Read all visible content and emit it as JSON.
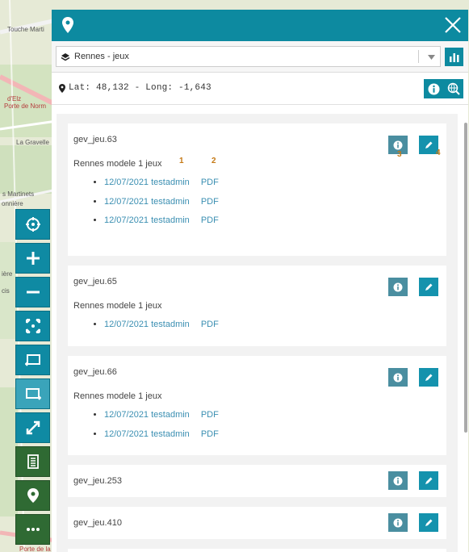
{
  "map": {
    "labels": {
      "touche": "Touche Marti",
      "porte_norm": "Porte de Norm",
      "elz": "d'Elz",
      "gravelle": "La Gravelle",
      "martinets": "s Martinets",
      "onniere": "onnière",
      "iere": "ière",
      "cis": "cis",
      "porte_bottom": "Porte de la"
    }
  },
  "toolbar": {
    "items": [
      {
        "name": "locate-icon"
      },
      {
        "name": "zoom-in-icon"
      },
      {
        "name": "zoom-out-icon"
      },
      {
        "name": "full-extent-icon"
      },
      {
        "name": "previous-extent-icon"
      },
      {
        "name": "next-extent-icon"
      },
      {
        "name": "fullscreen-icon"
      },
      {
        "name": "list-icon"
      },
      {
        "name": "map-marker-icon"
      },
      {
        "name": "more-icon"
      }
    ]
  },
  "panel": {
    "layer_select_value": "Rennes - jeux",
    "coordinates": "Lat: 48,132 - Long: -1,643",
    "items": [
      {
        "title": "gev_jeu.63",
        "subtitle": "Rennes modele 1 jeux",
        "docs": [
          {
            "link": "12/07/2021 testadmin",
            "pdf": "PDF"
          },
          {
            "link": "12/07/2021 testadmin",
            "pdf": "PDF"
          },
          {
            "link": "12/07/2021 testadmin",
            "pdf": "PDF"
          }
        ]
      },
      {
        "title": "gev_jeu.65",
        "subtitle": "Rennes modele 1 jeux",
        "docs": [
          {
            "link": "12/07/2021 testadmin",
            "pdf": "PDF"
          }
        ]
      },
      {
        "title": "gev_jeu.66",
        "subtitle": "Rennes modele 1 jeux",
        "docs": [
          {
            "link": "12/07/2021 testadmin",
            "pdf": "PDF"
          },
          {
            "link": "12/07/2021 testadmin",
            "pdf": "PDF"
          }
        ]
      },
      {
        "title": "gev_jeu.253"
      },
      {
        "title": "gev_jeu.410"
      }
    ],
    "annotations": [
      "1",
      "2",
      "3",
      "4"
    ]
  },
  "colors": {
    "accent": "#0d8aa0",
    "link": "#3b8fb2",
    "annotation": "#c57915",
    "toolbar_green": "#2f6a33"
  }
}
